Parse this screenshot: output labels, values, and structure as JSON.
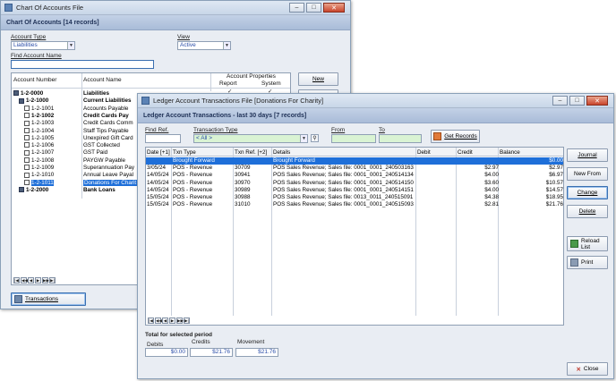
{
  "back_window": {
    "title": "Chart Of Accounts File",
    "header": "Chart Of Accounts [14 records]",
    "account_type_label": "Account Type",
    "account_type_value": "Liabilities",
    "view_label": "View",
    "view_value": "Active",
    "find_label": "Find Account Name",
    "col_number": "Account Number",
    "col_name": "Account Name",
    "props_label": "Account Properties",
    "report_label": "Report",
    "system_label": "System",
    "tree": [
      {
        "num": "1-2-0000",
        "name": "Liabilities",
        "bold": true,
        "indent": 0
      },
      {
        "num": "1-2-1000",
        "name": "Current Liabilities",
        "bold": true,
        "indent": 1
      },
      {
        "num": "1-2-1001",
        "name": "Accounts Payable",
        "bold": false,
        "indent": 2
      },
      {
        "num": "1-2-1002",
        "name": "Credit Cards Pay",
        "bold": true,
        "indent": 2
      },
      {
        "num": "1-2-1003",
        "name": "Credit Cards Comm",
        "bold": false,
        "indent": 2
      },
      {
        "num": "1-2-1004",
        "name": "Staff Tips Payable",
        "bold": false,
        "indent": 2
      },
      {
        "num": "1-2-1005",
        "name": "Unexpired Gift Card",
        "bold": false,
        "indent": 2
      },
      {
        "num": "1-2-1006",
        "name": "GST Collected",
        "bold": false,
        "indent": 2
      },
      {
        "num": "1-2-1007",
        "name": "GST Paid",
        "bold": false,
        "indent": 2
      },
      {
        "num": "1-2-1008",
        "name": "PAYGW Payable",
        "bold": false,
        "indent": 2
      },
      {
        "num": "1-2-1009",
        "name": "Superannuation Pay",
        "bold": false,
        "indent": 2
      },
      {
        "num": "1-2-1010",
        "name": "Annual Leave Payal",
        "bold": false,
        "indent": 2
      },
      {
        "num": "1-2-1011",
        "name": "Donations For Charit",
        "bold": false,
        "indent": 2,
        "selected": true
      },
      {
        "num": "1-2-2000",
        "name": "Bank Loans",
        "bold": true,
        "indent": 1
      }
    ],
    "new_label": "New",
    "transactions_label": "Transactions"
  },
  "front_window": {
    "title": "Ledger Account Transactions File [Donations For Charity]",
    "header": "Ledger Account Transactions - last 30 days [7 records]",
    "find_ref_label": "Find Ref.",
    "txn_type_label": "Transaction Type",
    "txn_type_value": "< All >",
    "from_label": "From",
    "to_label": "To",
    "get_records_label": "Get Records",
    "columns": [
      "Date [+1]",
      "Txn Type",
      "Txn Ref. [+2]",
      "Details",
      "Debit",
      "Credit",
      "Balance"
    ],
    "rows": [
      {
        "date": "",
        "type": "Brought Forward",
        "ref": "",
        "details": "Brought Forward",
        "debit": "",
        "credit": "",
        "balance": "$0.00",
        "selected": true
      },
      {
        "date": "3/05/24",
        "type": "POS - Revenue",
        "ref": "30709",
        "details": "POS Sales Revenue; Sales file: 0001_0001_240503163",
        "debit": "",
        "credit": "$2.97",
        "balance": "$2.97"
      },
      {
        "date": "14/05/24",
        "type": "POS - Revenue",
        "ref": "30941",
        "details": "POS Sales Revenue; Sales file: 0001_0001_240514134",
        "debit": "",
        "credit": "$4.00",
        "balance": "$6.97"
      },
      {
        "date": "14/05/24",
        "type": "POS - Revenue",
        "ref": "30970",
        "details": "POS Sales Revenue; Sales file: 0001_0001_240514150",
        "debit": "",
        "credit": "$3.60",
        "balance": "$10.57"
      },
      {
        "date": "14/05/24",
        "type": "POS - Revenue",
        "ref": "30989",
        "details": "POS Sales Revenue; Sales file: 0001_0001_240514151",
        "debit": "",
        "credit": "$4.00",
        "balance": "$14.57"
      },
      {
        "date": "15/05/24",
        "type": "POS - Revenue",
        "ref": "30988",
        "details": "POS Sales Revenue; Sales file: 0013_0011_240515091",
        "debit": "",
        "credit": "$4.38",
        "balance": "$18.95"
      },
      {
        "date": "15/05/24",
        "type": "POS - Revenue",
        "ref": "31010",
        "details": "POS Sales Revenue; Sales file: 0001_0001_240515093",
        "debit": "",
        "credit": "$2.81",
        "balance": "$21.76"
      }
    ],
    "buttons": {
      "journal": "Journal",
      "new_from": "New From",
      "change": "Change",
      "delete": "Delete",
      "reload": "Reload List",
      "print": "Print",
      "close": "Close"
    },
    "totals_label": "Total for selected period",
    "debits_label": "Debits",
    "debits_value": "$0.00",
    "credits_label": "Credits",
    "credits_value": "$21.76",
    "movement_label": "Movement",
    "movement_value": "$21.76"
  }
}
